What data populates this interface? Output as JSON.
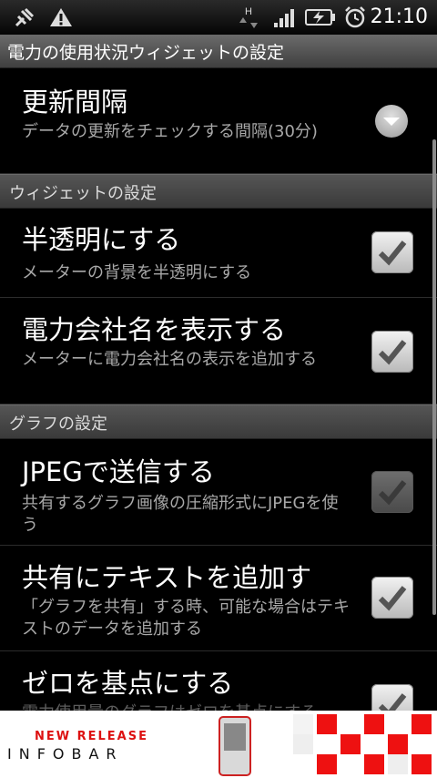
{
  "status_bar": {
    "time": "21:10",
    "network_type": "H",
    "icons": [
      "usb-debug-icon",
      "warning-icon",
      "data-transfer-icon",
      "signal-icon",
      "battery-charging-icon",
      "alarm-icon"
    ]
  },
  "title_bar": {
    "title": "電力の使用状況ウィジェットの設定"
  },
  "items": [
    {
      "title": "更新間隔",
      "summary": "データの更新をチェックする間隔(30分)",
      "control": "dropdown"
    },
    {
      "section": "ウィジェットの設定"
    },
    {
      "title": "半透明にする",
      "summary": "メーターの背景を半透明にする",
      "checked": true,
      "enabled": true
    },
    {
      "title": "電力会社名を表示する",
      "summary": "メーターに電力会社名の表示を追加する",
      "checked": true,
      "enabled": true
    },
    {
      "section": "グラフの設定"
    },
    {
      "title": "JPEGで送信する",
      "summary": "共有するグラフ画像の圧縮形式にJPEGを使う",
      "checked": true,
      "enabled": false
    },
    {
      "title": "共有にテキストを追加す",
      "summary": "「グラフを共有」する時、可能な場合はテキストのデータを追加する",
      "checked": true,
      "enabled": true
    },
    {
      "title": "ゼロを基点にする",
      "summary": "電力使用量のグラフはゼロを基点にする",
      "checked": true,
      "enabled": true
    }
  ],
  "ad_banner": {
    "tagline": "NEW RELEASE",
    "brand": "INFOBAR"
  },
  "colors": {
    "accent_red": "#d11111",
    "section_bg": "#4a4a4a",
    "summary_text": "#a8a8a8"
  }
}
